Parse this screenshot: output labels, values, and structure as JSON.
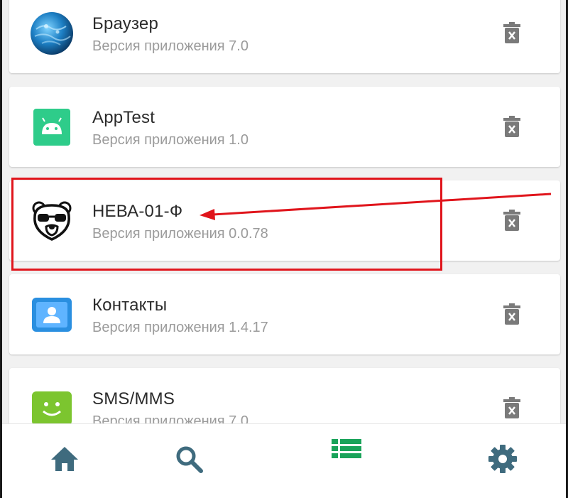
{
  "apps": [
    {
      "name": "Браузер",
      "version": "Версия приложения 7.0",
      "icon": "browser-globe-icon"
    },
    {
      "name": "AppTest",
      "version": "Версия приложения 1.0",
      "icon": "android-icon"
    },
    {
      "name": "НЕВА-01-Ф",
      "version": "Версия приложения 0.0.78",
      "icon": "bear-glasses-icon"
    },
    {
      "name": "Контакты",
      "version": "Версия приложения 1.4.17",
      "icon": "contacts-icon"
    },
    {
      "name": "SMS/MMS",
      "version": "Версия приложения 7.0",
      "icon": "sms-smile-icon"
    }
  ],
  "nav": [
    {
      "icon": "home-icon",
      "active": false
    },
    {
      "icon": "search-icon",
      "active": false
    },
    {
      "icon": "list-icon",
      "active": true
    },
    {
      "icon": "gear-icon",
      "active": false
    }
  ],
  "colors": {
    "primary": "#3f6b7e",
    "active": "#1aa35a",
    "annotation": "#e0151c",
    "subtitle": "#9b9b9b",
    "trash": "#7a7a7a"
  }
}
